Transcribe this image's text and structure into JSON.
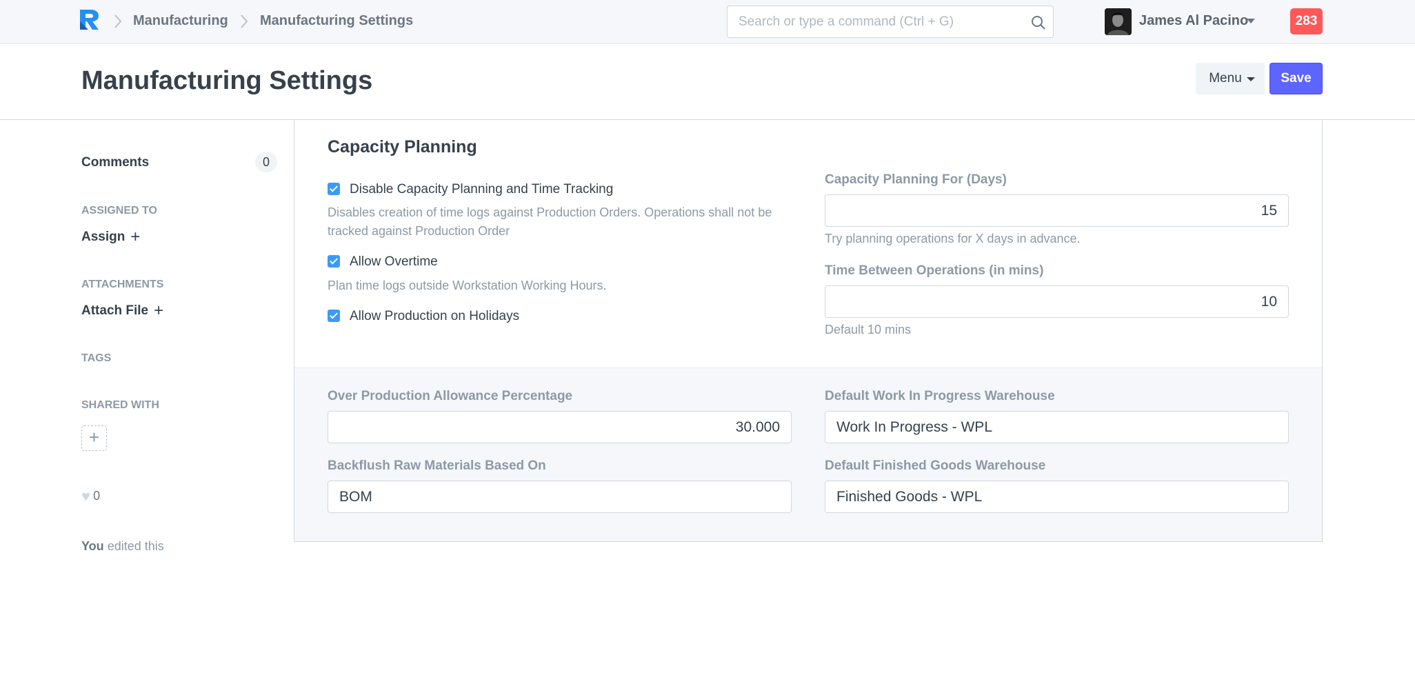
{
  "navbar": {
    "breadcrumbs": [
      "Manufacturing",
      "Manufacturing Settings"
    ],
    "search_placeholder": "Search or type a command (Ctrl + G)",
    "user_name": "James Al Pacino",
    "notification_count": "283",
    "icons": {
      "logo": "app-logo-icon",
      "search": "search-icon",
      "caret": "chevron-down-icon"
    }
  },
  "page": {
    "title": "Manufacturing Settings",
    "menu_label": "Menu",
    "save_label": "Save",
    "accent_color": "#5e64ff"
  },
  "sidebar": {
    "comments_label": "Comments",
    "comments_count": "0",
    "assigned_to_label": "ASSIGNED TO",
    "assign_label": "Assign",
    "attachments_label": "ATTACHMENTS",
    "attach_label": "Attach File",
    "tags_label": "TAGS",
    "shared_with_label": "SHARED WITH",
    "likes_count": "0",
    "activity_actor": "You",
    "activity_text": "edited this"
  },
  "capacity_planning": {
    "title": "Capacity Planning",
    "checkboxes": [
      {
        "label": "Disable Capacity Planning and Time Tracking",
        "checked": true,
        "help": "Disables creation of time logs against Production Orders. Operations shall not be tracked against Production Order"
      },
      {
        "label": "Allow Overtime",
        "checked": true,
        "help": "Plan time logs outside Workstation Working Hours."
      },
      {
        "label": "Allow Production on Holidays",
        "checked": true,
        "help": ""
      }
    ],
    "capacity_days": {
      "label": "Capacity Planning For (Days)",
      "value": "15",
      "help": "Try planning operations for X days in advance."
    },
    "time_between": {
      "label": "Time Between Operations (in mins)",
      "value": "10",
      "help": "Default 10 mins"
    }
  },
  "settings": {
    "over_production": {
      "label": "Over Production Allowance Percentage",
      "value": "30.000"
    },
    "backflush": {
      "label": "Backflush Raw Materials Based On",
      "value": "BOM"
    },
    "wip_warehouse": {
      "label": "Default Work In Progress Warehouse",
      "value": "Work In Progress - WPL"
    },
    "fg_warehouse": {
      "label": "Default Finished Goods Warehouse",
      "value": "Finished Goods - WPL"
    }
  }
}
